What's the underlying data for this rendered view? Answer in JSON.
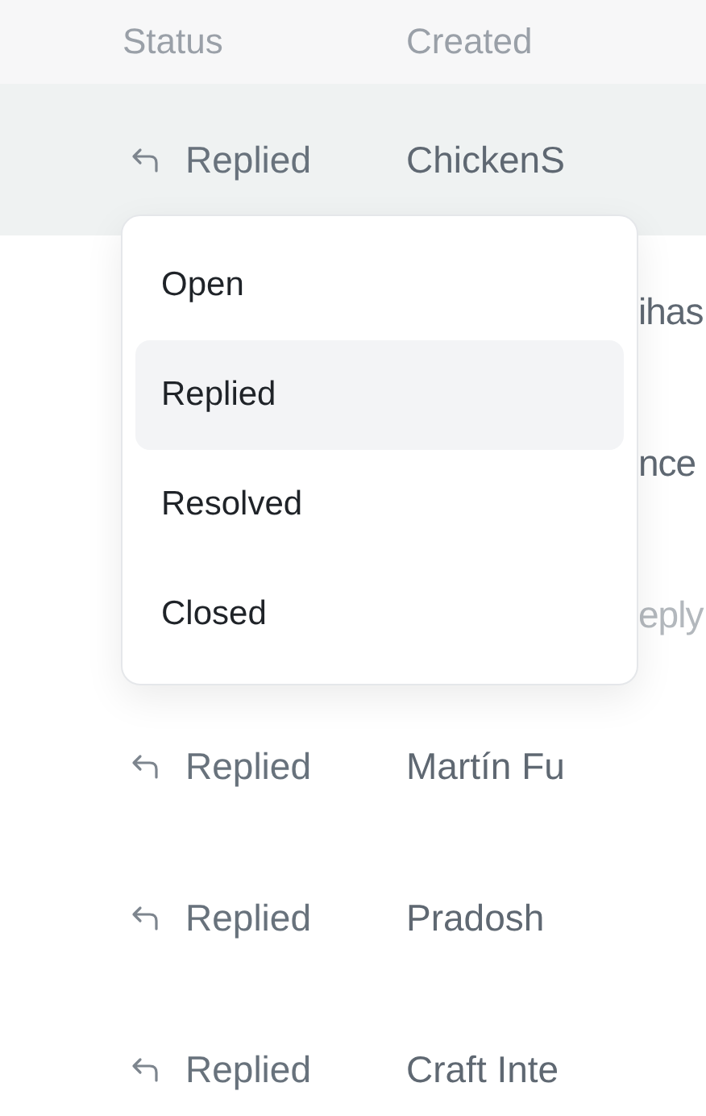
{
  "columns": [
    "Status",
    "Created"
  ],
  "rows": [
    {
      "kind": "full",
      "status": "Replied",
      "created": "ChickenS",
      "selected": true,
      "muted": false
    },
    {
      "kind": "covered",
      "created": "ihas",
      "selected": false,
      "muted": false
    },
    {
      "kind": "covered",
      "created": "nce",
      "selected": false,
      "muted": false
    },
    {
      "kind": "covered",
      "created": "eply",
      "selected": false,
      "muted": true
    },
    {
      "kind": "full",
      "status": "Replied",
      "created": "Martín Fu",
      "selected": false,
      "muted": false
    },
    {
      "kind": "full",
      "status": "Replied",
      "created": "Pradosh",
      "selected": false,
      "muted": false
    },
    {
      "kind": "full",
      "status": "Replied",
      "created": "Craft Inte",
      "selected": false,
      "muted": false
    }
  ],
  "menu": {
    "items": [
      {
        "label": "Open",
        "selected": false
      },
      {
        "label": "Replied",
        "selected": true
      },
      {
        "label": "Resolved",
        "selected": false
      },
      {
        "label": "Closed",
        "selected": false
      }
    ]
  }
}
